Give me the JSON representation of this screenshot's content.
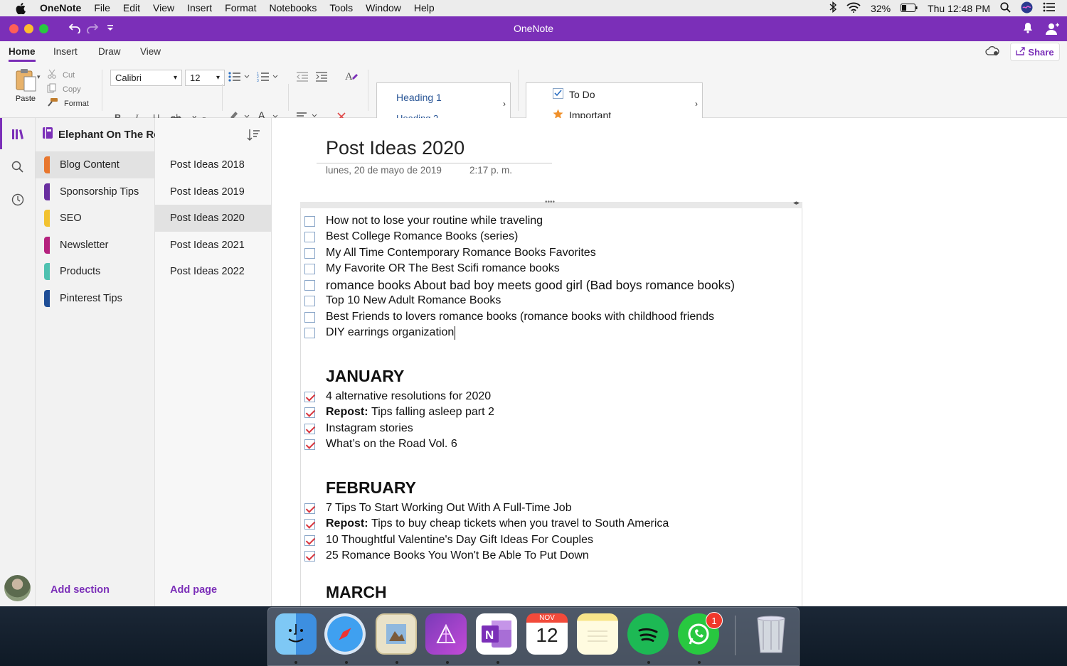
{
  "menubar": {
    "app_name": "OneNote",
    "items": [
      "File",
      "Edit",
      "View",
      "Insert",
      "Format",
      "Notebooks",
      "Tools",
      "Window",
      "Help"
    ],
    "battery": "32%",
    "clock": "Thu 12:48 PM"
  },
  "window": {
    "title": "OneNote"
  },
  "ribbon": {
    "tabs": [
      "Home",
      "Insert",
      "Draw",
      "View"
    ],
    "share_label": "Share",
    "paste_label": "Paste",
    "cut_label": "Cut",
    "copy_label": "Copy",
    "format_label": "Format",
    "font_name": "Calibri",
    "font_size": "12",
    "styles": {
      "heading1": "Heading 1",
      "heading2": "Heading 2"
    },
    "tags": {
      "todo": "To Do",
      "important": "Important"
    }
  },
  "notebook": {
    "name": "Elephant On The Road",
    "sections": [
      {
        "label": "Blog Content",
        "color": "#e8772e"
      },
      {
        "label": "Sponsorship Tips",
        "color": "#6a2fa0"
      },
      {
        "label": "SEO",
        "color": "#f2c230"
      },
      {
        "label": "Newsletter",
        "color": "#b5227e"
      },
      {
        "label": "Products",
        "color": "#4fc1b0"
      },
      {
        "label": "Pinterest Tips",
        "color": "#1f4e96"
      }
    ],
    "add_section": "Add section"
  },
  "pages": {
    "items": [
      "Post Ideas 2018",
      "Post Ideas 2019",
      "Post Ideas 2020",
      "Post Ideas 2021",
      "Post Ideas 2022"
    ],
    "add_page": "Add page"
  },
  "note": {
    "title": "Post Ideas 2020",
    "date": "lunes, 20 de mayo de 2019",
    "time": "2:17 p. m.",
    "ideas": [
      "How not to lose your routine while traveling",
      "Best College Romance Books (series)",
      "My All Time Contemporary Romance Books Favorites",
      "My Favorite OR The Best Scifi romance books",
      "romance books About bad boy meets good girl (Bad boys romance books)",
      "Top 10 New Adult Romance Books",
      "Best Friends to lovers romance books (romance books with childhood friends",
      "DIY earrings organization"
    ],
    "january": {
      "heading": "JANUARY",
      "items": [
        "4 alternative resolutions for 2020",
        "Tips falling asleep part 2",
        "Instagram stories",
        "What’s on the Road Vol. 6"
      ],
      "repost_label": "Repost:"
    },
    "february": {
      "heading": "FEBRUARY",
      "items": [
        "7 Tips To Start Working Out With A Full-Time Job",
        "Tips to buy cheap tickets when you travel to South America",
        "10 Thoughtful Valentine's Day Gift Ideas For Couples",
        "25 Romance Books You Won't Be Able To Put Down"
      ],
      "repost_label": "Repost:"
    },
    "march": {
      "heading": "MARCH"
    }
  },
  "dock": {
    "apps": [
      "finder-icon",
      "safari-icon",
      "preview-icon",
      "affinity-photo-icon",
      "onenote-icon",
      "calendar-icon",
      "notes-icon",
      "spotify-icon",
      "whatsapp-icon",
      "trash-icon"
    ],
    "calendar_month": "NOV",
    "calendar_day": "12",
    "whatsapp_badge": "1"
  }
}
